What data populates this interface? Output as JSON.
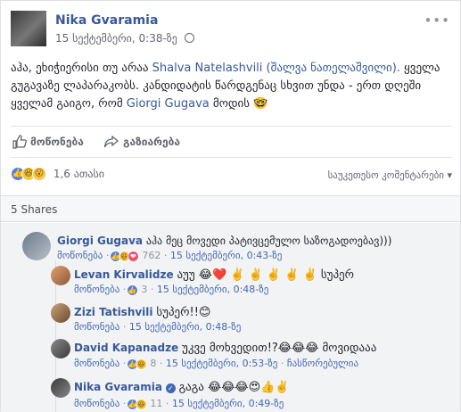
{
  "post": {
    "author": "Nika Gvaramia",
    "timestamp": "15 სექტემბერი, 0:38-ზე",
    "text_part1": "აჰა, ეხიჭიერისი თუ არაა ",
    "mention1": "Shalva Natelashvili (შალვა ნათელაშვილი).",
    "text_part2": " ყველა გუგავაზე ლაპარაკობს. კანდიდატის წარდგენაც სხვით უნდა - ერთ დღეში ყველამ გაიგო, რომ ",
    "mention2": "Giorgi Gugava",
    "text_part3": " მოდის 🤓"
  },
  "actions": {
    "like_label": "მოწონება",
    "share_label": "გაზიარება"
  },
  "summary": {
    "reaction_count": "1,6 ათასი",
    "sort_label": "საუკეთესო კომენტარები ▾"
  },
  "shares": "5 Shares",
  "comments": [
    {
      "author": "Giorgi Gugava",
      "text": "აჰა მეც მოვედი პატივცემულო საზოგადოებავ)))",
      "like": "მოწონება",
      "count": "762",
      "time": "15 სექტემბერი, 0:43-ზე"
    },
    {
      "author": "Levan Kirvalidze",
      "text": "აუუ 😂❤️ ✌️ ✌️ ✌️ ✌️ ✌️ სუპერ",
      "like": "მოწონება",
      "count": "3",
      "time": "15 სექტემბერი, 0:48-ზე"
    },
    {
      "author": "Zizi Tatishvili",
      "text": "სუპერ!!😊",
      "like": "მოწონება",
      "time": "15 სექტემბერი, 0:48-ზე"
    },
    {
      "author": "David Kapanadze",
      "text": "უკვე მოხვედით!?😂😂😂 მოვიდააა",
      "like": "მოწონება",
      "count": "8",
      "time": "15 სექტემბერი, 0:53-ზე",
      "edited": "ჩასწორებულია"
    },
    {
      "author": "Nika Gvaramia",
      "text": "გაგა 😂😂😂😍👍✌️",
      "like": "მოწონება",
      "count": "11",
      "time": "15 სექტემბერი, 0:49-ზე"
    }
  ],
  "colors": {
    "link": "#385898",
    "accent": "#4267b2"
  }
}
